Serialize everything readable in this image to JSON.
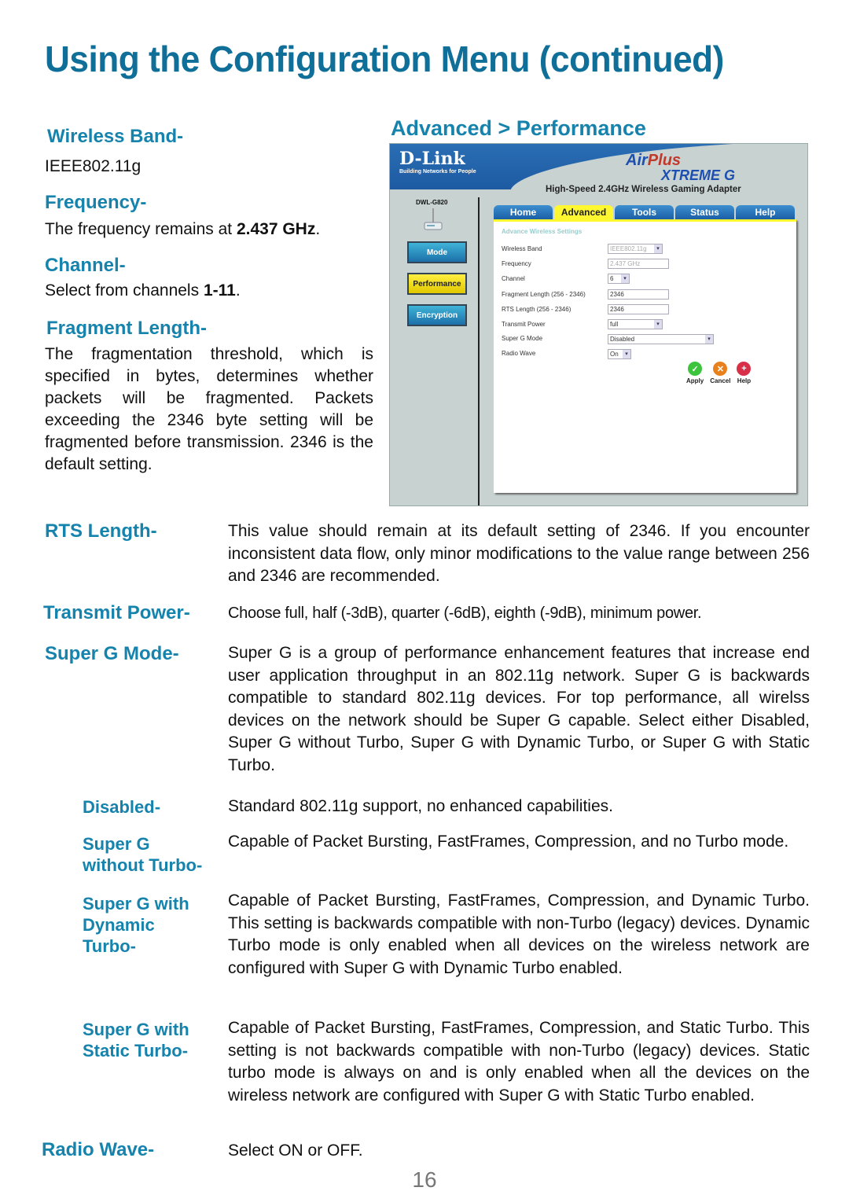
{
  "page": {
    "title": "Using the Configuration Menu (continued)",
    "page_number": "16"
  },
  "left": {
    "wireless_band": {
      "heading": "Wireless Band-",
      "text": "IEEE802.11g"
    },
    "frequency": {
      "heading": "Frequency-",
      "text_pre": "The frequency remains at ",
      "text_bold": "2.437 GHz",
      "text_post": "."
    },
    "channel": {
      "heading": "Channel-",
      "text_pre": "Select from channels ",
      "text_bold": "1-11",
      "text_post": "."
    },
    "fragment": {
      "heading": "Fragment Length-",
      "text": "The fragmentation threshold, which is specified in bytes, determines whether packets will be fragmented. Packets exceeding the 2346 byte setting will be fragmented before transmission. 2346 is the default setting."
    }
  },
  "screenshot": {
    "caption": "Advanced > Performance",
    "brand": "D-Link",
    "brand_tagline": "Building Networks for People",
    "product_air": "Air",
    "product_plus": "Plus",
    "product_xtreme": "XTREME G",
    "product_subtitle": "High-Speed 2.4GHz Wireless Gaming Adapter",
    "model": "DWL-G820",
    "side_buttons": [
      "Mode",
      "Performance",
      "Encryption"
    ],
    "tabs": [
      "Home",
      "Advanced",
      "Tools",
      "Status",
      "Help"
    ],
    "active_tab": "Advanced",
    "panel_title": "Advance Wireless Settings",
    "fields": [
      {
        "label": "Wireless Band",
        "value": "IEEE802.11g",
        "type": "select-disabled"
      },
      {
        "label": "Frequency",
        "value": "2.437 GHz",
        "type": "text-disabled"
      },
      {
        "label": "Channel",
        "value": "6",
        "type": "select"
      },
      {
        "label": "Fragment Length (256 - 2346)",
        "value": "2346",
        "type": "text"
      },
      {
        "label": "RTS Length (256 - 2346)",
        "value": "2346",
        "type": "text"
      },
      {
        "label": "Transmit Power",
        "value": "full",
        "type": "select"
      },
      {
        "label": "Super G Mode",
        "value": "Disabled",
        "type": "select"
      },
      {
        "label": "Radio Wave",
        "value": "On",
        "type": "select"
      }
    ],
    "actions": [
      {
        "label": "Apply",
        "icon": "check-icon",
        "color": "#3cc43c"
      },
      {
        "label": "Cancel",
        "icon": "x-icon",
        "color": "#e8801c"
      },
      {
        "label": "Help",
        "icon": "plus-icon",
        "color": "#d83048"
      }
    ]
  },
  "sections": [
    {
      "heading": "RTS Length-",
      "text": "This value should remain at its default setting of 2346. If you encounter inconsistent data flow, only minor modifications to the value range between 256 and 2346 are recommended."
    },
    {
      "heading": "Transmit Power-",
      "text": "Choose full, half (-3dB), quarter (-6dB), eighth (-9dB), minimum power."
    },
    {
      "heading": "Super G Mode-",
      "text": "Super G is a group of performance enhancement features that increase end user application throughput in an 802.11g network. Super G is backwards compatible to standard 802.11g devices. For top performance, all wirelss devices on the network should be Super G capable. Select either Disabled, Super G without Turbo, Super G with Dynamic Turbo, or Super G with Static Turbo."
    },
    {
      "heading": "Radio Wave-",
      "text": "Select ON or OFF."
    }
  ],
  "super_g_modes": [
    {
      "heading_lines": [
        "Disabled-"
      ],
      "text": "Standard 802.11g support, no enhanced capabilities."
    },
    {
      "heading_lines": [
        "Super G",
        "without Turbo-"
      ],
      "text": "Capable of Packet Bursting, FastFrames, Compression, and no Turbo mode."
    },
    {
      "heading_lines": [
        "Super G with",
        "Dynamic",
        "Turbo-"
      ],
      "text": "Capable of Packet Bursting, FastFrames, Compression, and Dynamic Turbo. This setting is backwards compatible with non-Turbo (legacy) devices. Dynamic Turbo mode is only enabled when all devices on the wireless network are configured with Super G with Dynamic Turbo enabled."
    },
    {
      "heading_lines": [
        "Super G with",
        "Static Turbo-"
      ],
      "text": "Capable of Packet Bursting, FastFrames, Compression, and Static Turbo. This setting is not backwards compatible with non-Turbo (legacy) devices. Static turbo mode is always on and is only enabled when all the devices on the wireless network are configured with Super G with Static Turbo enabled."
    }
  ],
  "colors": {
    "heading": "#1683ad",
    "title": "#0f6f98"
  }
}
